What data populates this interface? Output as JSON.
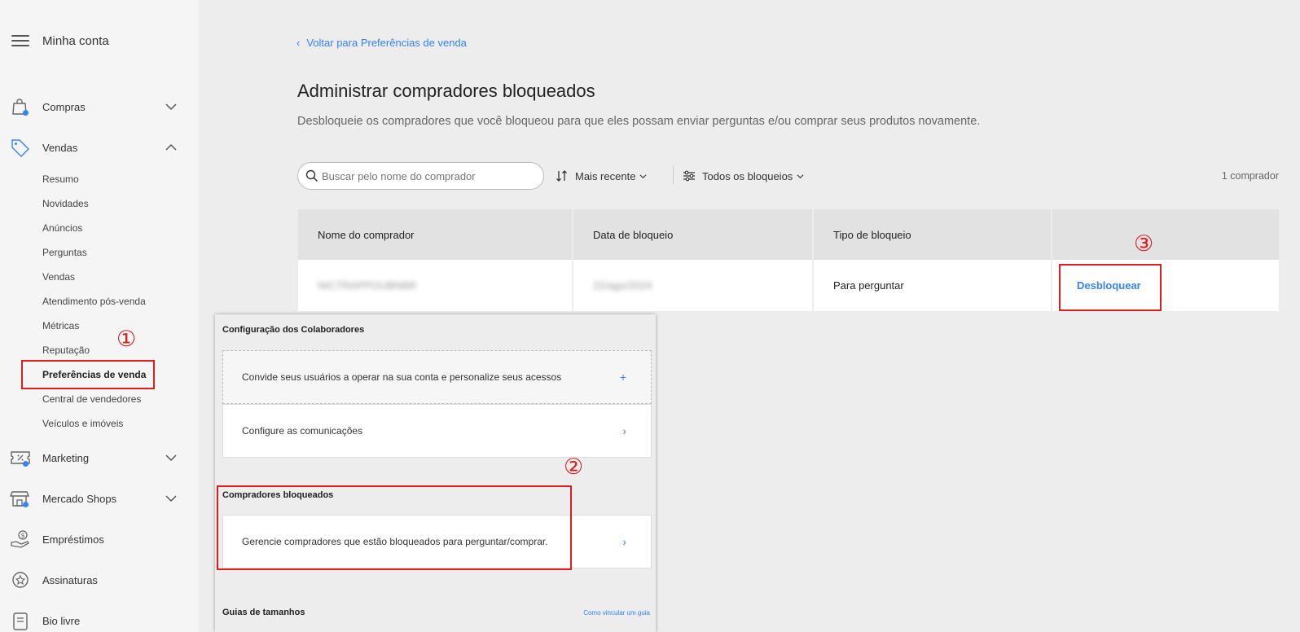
{
  "sidebar": {
    "title": "Minha conta",
    "sections": [
      {
        "label": "Compras",
        "icon": "shopping-bag-icon"
      },
      {
        "label": "Vendas",
        "icon": "price-tag-icon"
      },
      {
        "label": "Marketing",
        "icon": "coupon-icon"
      },
      {
        "label": "Mercado Shops",
        "icon": "storefront-icon"
      },
      {
        "label": "Empréstimos",
        "icon": "hand-money-icon"
      },
      {
        "label": "Assinaturas",
        "icon": "star-badge-icon"
      },
      {
        "label": "Bio livre",
        "icon": "bio-page-icon"
      }
    ],
    "sales_items": [
      "Resumo",
      "Novidades",
      "Anúncios",
      "Perguntas",
      "Vendas",
      "Atendimento pós-venda",
      "Métricas",
      "Reputação",
      "Preferências de venda",
      "Central de vendedores",
      "Veículos e imóveis"
    ]
  },
  "annotations": {
    "one": "①",
    "two": "②",
    "three": "③"
  },
  "main": {
    "back_link": "Voltar para Preferências de venda",
    "title": "Administrar compradores bloqueados",
    "description": "Desbloqueie os compradores que você bloqueou para que eles possam enviar perguntas e/ou comprar seus produtos novamente.",
    "search_placeholder": "Buscar pelo nome do comprador",
    "sort_label": "Mais recente",
    "filter_label": "Todos os bloqueios",
    "count": "1 comprador",
    "table": {
      "headers": [
        "Nome do comprador",
        "Data de bloqueio",
        "Tipo de bloqueio",
        ""
      ],
      "row": {
        "name": "NICTRAPPOUBNBR",
        "date": "22/ago/2024",
        "type": "Para perguntar",
        "action": "Desbloquear"
      }
    }
  },
  "panel": {
    "section1_title": "Configuração dos Colaboradores",
    "invite_text": "Convide seus usuários a operar na sua conta e personalize seus acessos",
    "comm_text": "Configure as comunicações",
    "section2_title": "Compradores bloqueados",
    "blocked_text": "Gerencie compradores que estão bloqueados para perguntar/comprar.",
    "section3_title": "Guias de tamanhos",
    "guide_link": "Como vincular um guia",
    "plus": "+",
    "chevron": "›"
  },
  "colors": {
    "accent": "#3483fa",
    "highlight": "#e01e1e"
  }
}
